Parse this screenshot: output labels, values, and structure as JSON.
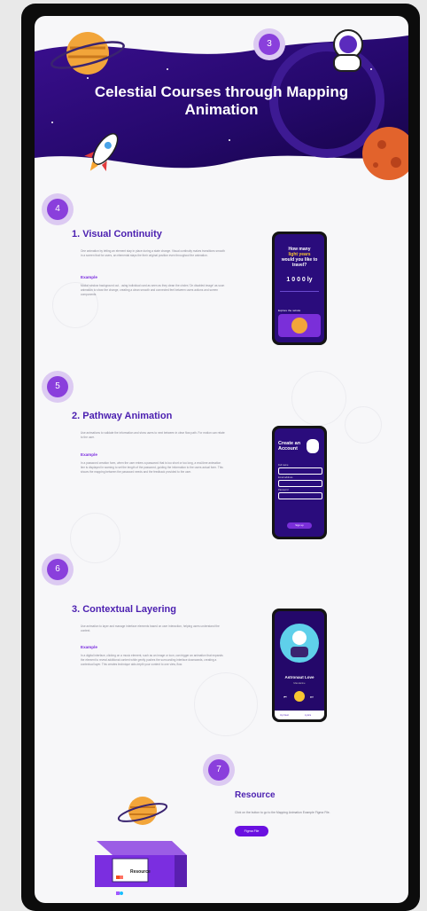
{
  "hero": {
    "title": "Celestial Courses through Mapping Animation",
    "step": "3"
  },
  "sections": [
    {
      "step": "4",
      "title": "1. Visual Continuity",
      "body": "One animation by letting an element stay in place during a state change. Visual continuity makes transitions smooth in a screen that for users, an elemental stays the their original position even throughout the animation.",
      "example_label": "Example",
      "example_body": "Modal window background out.. using individual card as seen as they clean the circles 'On disabled image' as soon animation to show the change, creating a clean smooth and connected feel between users actions and screen components",
      "phone": {
        "line1": "How many",
        "line2": "light years",
        "line3": "would you like to",
        "line4": "travel?",
        "value": "1 0 0 0  ly",
        "caption": "Explore the nebula"
      }
    },
    {
      "step": "5",
      "title": "2. Pathway Animation",
      "body": "Use animations to validate the information and show users to next between in clear flow path. For motion can relate to the user.",
      "example_label": "Example",
      "example_body": "In a password creation form, when the user enters a password that is too short or too long, a real-time animation line is displayed in warning to set the length of the password, guiding the information to the users actual form. This shows the mapping between the password needs and the feedback provided to the user.",
      "phone": {
        "title_line1": "Create an",
        "title_line2": "Account",
        "field1": "Full name",
        "field2": "Email address",
        "field3": "Password",
        "button": "Sign up"
      }
    },
    {
      "step": "6",
      "title": "3. Contextual Layering",
      "body": "Use animation to layer and manage interface elements based on user interaction, helping users understand the context.",
      "example_label": "Example",
      "example_body": "In a digital interface, clicking on a music element, such as an image or icon, can trigger an animation that expands the element to reveal additional content while gently pushes the surrounding interface downwards, creating a contextual layer. This creates technique aids depth your content to one view, flow.",
      "phone": {
        "song": "Astronaut Love",
        "artist": "Mandarine",
        "tab1": "Up Next",
        "tab2": "Lyrics"
      }
    }
  ],
  "resource": {
    "step": "7",
    "title": "Resource",
    "text": "Click on the button to go to the Mapping Animation Example Figma File.",
    "button": "Figma File",
    "box_label": "Resource"
  },
  "colors": {
    "accent": "#4b1fb0",
    "purple": "#7b2ee0",
    "badge_outer": "#dccaf2",
    "badge_inner": "#8a3fdc",
    "hero": "#2b0a78"
  }
}
